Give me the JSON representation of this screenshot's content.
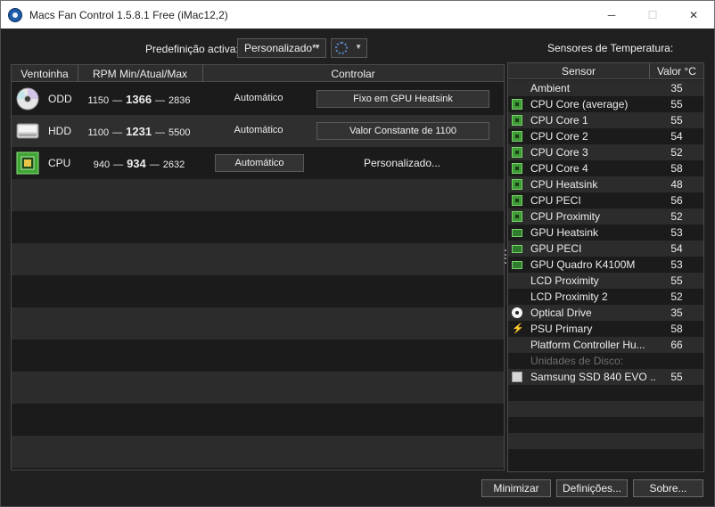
{
  "window": {
    "title": "Macs Fan Control 1.5.8.1 Free (iMac12,2)",
    "minimize_glyph": "─",
    "maximize_glyph": "☐",
    "close_glyph": "✕"
  },
  "preset": {
    "label": "Predefinição activa:",
    "selected": "Personalizado*"
  },
  "fan_table": {
    "headers": [
      "Ventoinha",
      "RPM Min/Atual/Max",
      "Controlar"
    ],
    "rows": [
      {
        "name": "ODD",
        "icon": "optical-drive-icon",
        "min": "1150",
        "current": "1366",
        "max": "2836",
        "mode_text": "Automático",
        "button_label": "Fixo em GPU Heatsink"
      },
      {
        "name": "HDD",
        "icon": "hard-drive-icon",
        "min": "1100",
        "current": "1231",
        "max": "5500",
        "mode_text": "Automático",
        "button_label": "Valor Constante de 1100"
      },
      {
        "name": "CPU",
        "icon": "cpu-chip-icon",
        "min": "940",
        "current": "934",
        "max": "2632",
        "button_label": "Automático",
        "custom_text": "Personalizado..."
      }
    ],
    "separator": "—"
  },
  "sensors": {
    "title": "Sensores de Temperatura:",
    "headers": [
      "Sensor",
      "Valor °C"
    ],
    "rows": [
      {
        "name": "Ambient",
        "value": "35",
        "icon": "none"
      },
      {
        "name": "CPU Core (average)",
        "value": "55",
        "icon": "cpu-chip-icon"
      },
      {
        "name": "CPU Core 1",
        "value": "55",
        "icon": "cpu-chip-icon"
      },
      {
        "name": "CPU Core 2",
        "value": "54",
        "icon": "cpu-chip-icon"
      },
      {
        "name": "CPU Core 3",
        "value": "52",
        "icon": "cpu-chip-icon"
      },
      {
        "name": "CPU Core 4",
        "value": "58",
        "icon": "cpu-chip-icon"
      },
      {
        "name": "CPU Heatsink",
        "value": "48",
        "icon": "cpu-chip-icon"
      },
      {
        "name": "CPU PECI",
        "value": "56",
        "icon": "cpu-chip-icon"
      },
      {
        "name": "CPU Proximity",
        "value": "52",
        "icon": "cpu-chip-icon"
      },
      {
        "name": "GPU Heatsink",
        "value": "53",
        "icon": "gpu-card-icon"
      },
      {
        "name": "GPU PECI",
        "value": "54",
        "icon": "gpu-card-icon"
      },
      {
        "name": "GPU Quadro K4100M",
        "value": "53",
        "icon": "gpu-card-icon"
      },
      {
        "name": "LCD Proximity",
        "value": "55",
        "icon": "none"
      },
      {
        "name": "LCD Proximity 2",
        "value": "52",
        "icon": "none"
      },
      {
        "name": "Optical Drive",
        "value": "35",
        "icon": "optical-drive-icon"
      },
      {
        "name": "PSU Primary",
        "value": "58",
        "icon": "lightning-icon"
      },
      {
        "name": "Platform Controller Hu...",
        "value": "66",
        "icon": "none"
      }
    ],
    "disk_section_label": "Unidades de Disco:",
    "disk_rows": [
      {
        "name": "Samsung SSD 840 EVO ...",
        "value": "55",
        "icon": "ssd-icon"
      }
    ]
  },
  "buttons": {
    "minimize": "Minimizar",
    "settings": "Definições...",
    "about": "Sobre..."
  },
  "colors": {
    "background": "#202020",
    "chip_green": "#3e9c35",
    "title_bar": "#ffffff"
  }
}
